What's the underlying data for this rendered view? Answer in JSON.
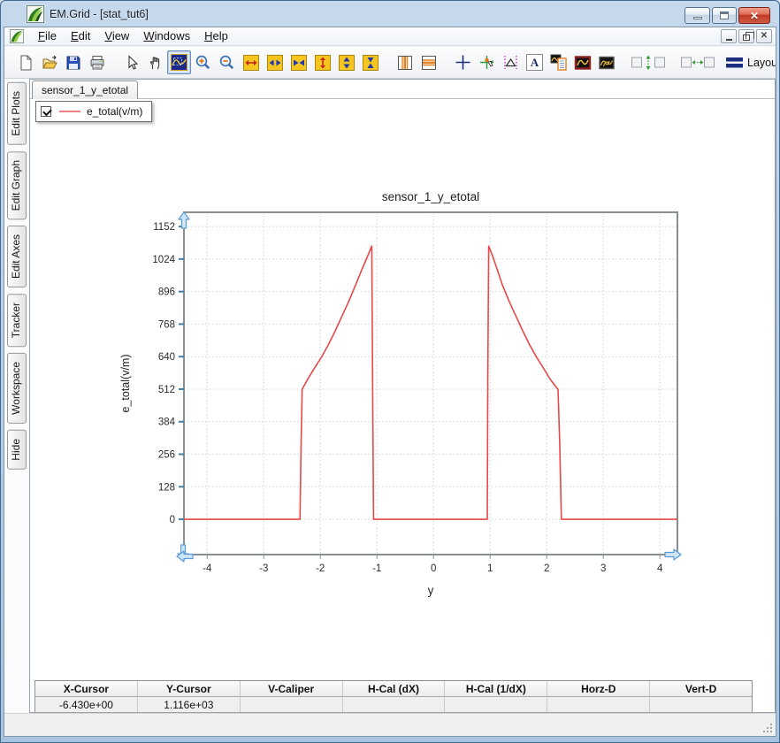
{
  "window": {
    "title": "EM.Grid - [stat_tut6]",
    "controls": [
      "minimize",
      "maximize",
      "close"
    ],
    "mdi_controls": [
      "minimize",
      "restore",
      "close"
    ]
  },
  "menu": {
    "items": [
      {
        "label": "File"
      },
      {
        "label": "Edit"
      },
      {
        "label": "View"
      },
      {
        "label": "Windows"
      },
      {
        "label": "Help"
      }
    ]
  },
  "toolbar": {
    "icons": [
      "new-document",
      "open-file",
      "save",
      "print",
      "select-cursor",
      "pan-hand",
      "zoom-box",
      "zoom-in",
      "zoom-out",
      "full-extent-x",
      "expand-x",
      "shrink-x",
      "full-extent-y",
      "expand-y",
      "shrink-y",
      "vertical-grid-markers",
      "horizontal-grid-markers",
      "crosshair",
      "tracker",
      "caliper",
      "text-annotation",
      "plot-properties",
      "active-graph",
      "all-graphs",
      "sync-vertical",
      "sync-horizontal",
      "layout"
    ],
    "selected_icon": "zoom-box",
    "a_glyph": "A",
    "layout_label": "Layout"
  },
  "sidebar": {
    "items": [
      {
        "label": "Edit Plots"
      },
      {
        "label": "Edit Graph"
      },
      {
        "label": "Edit Axes"
      },
      {
        "label": "Tracker"
      },
      {
        "label": "Workspace"
      },
      {
        "label": "Hide"
      }
    ]
  },
  "tabs": {
    "active": "sensor_1_y_etotal"
  },
  "legend": {
    "checked": true,
    "label": "e_total(v/m)",
    "line_color": "#ee8080"
  },
  "chart_data": {
    "type": "line",
    "title": "sensor_1_y_etotal",
    "xlabel": "y",
    "ylabel": "e_total(v/m)",
    "x_ticks": [
      -4,
      -3,
      -2,
      -1,
      0,
      1,
      2,
      3,
      4
    ],
    "y_ticks": [
      0,
      128,
      256,
      384,
      512,
      640,
      768,
      896,
      1024,
      1152
    ],
    "xlim": [
      -4.41,
      4.31
    ],
    "ylim": [
      -139,
      1208
    ],
    "grid": true,
    "legend_position": "top-left",
    "series": [
      {
        "name": "e_total(v/m)",
        "color": "#e84848",
        "points": [
          [
            -4.41,
            0
          ],
          [
            -2.36,
            0
          ],
          [
            -2.34,
            300
          ],
          [
            -2.32,
            512
          ],
          [
            -2.22,
            552
          ],
          [
            -2.1,
            596
          ],
          [
            -1.98,
            638
          ],
          [
            -1.86,
            686
          ],
          [
            -1.74,
            740
          ],
          [
            -1.62,
            798
          ],
          [
            -1.5,
            856
          ],
          [
            -1.38,
            920
          ],
          [
            -1.26,
            986
          ],
          [
            -1.16,
            1038
          ],
          [
            -1.09,
            1075
          ],
          [
            -1.075,
            500
          ],
          [
            -1.06,
            0
          ],
          [
            0.95,
            0
          ],
          [
            0.96,
            560
          ],
          [
            0.975,
            1075
          ],
          [
            1.04,
            1038
          ],
          [
            1.12,
            986
          ],
          [
            1.22,
            920
          ],
          [
            1.34,
            856
          ],
          [
            1.46,
            798
          ],
          [
            1.58,
            740
          ],
          [
            1.7,
            686
          ],
          [
            1.82,
            638
          ],
          [
            1.94,
            596
          ],
          [
            2.06,
            552
          ],
          [
            2.16,
            522
          ],
          [
            2.2,
            512
          ],
          [
            2.23,
            300
          ],
          [
            2.26,
            0
          ],
          [
            4.31,
            0
          ]
        ]
      }
    ]
  },
  "status_table": {
    "headers": [
      "X-Cursor",
      "Y-Cursor",
      "V-Caliper",
      "H-Cal (dX)",
      "H-Cal (1/dX)",
      "Horz-D",
      "Vert-D"
    ],
    "values": [
      "-6.430e+00",
      "1.116e+03",
      "",
      "",
      "",
      "",
      ""
    ]
  },
  "colors": {
    "plot_line": "#e84848",
    "axis_arrow_fill": "#cfe6f8",
    "axis_arrow_stroke": "#5b9bd5",
    "frame": "#898e93",
    "titlebar_close": "#c03823"
  }
}
